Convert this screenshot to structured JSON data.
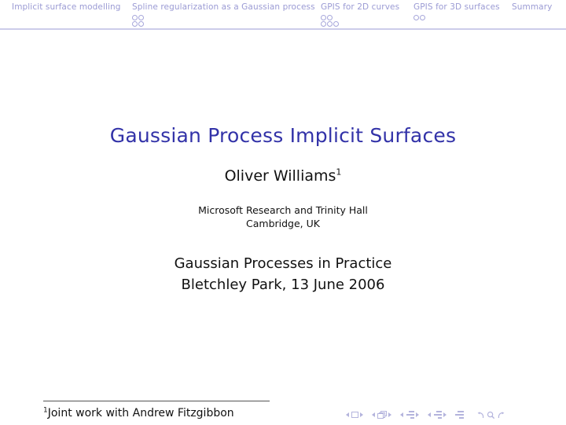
{
  "slide": {
    "type": "beamer-title-slide",
    "background_color": "#ffffff",
    "accent_color": "#3232a8",
    "nav_color": "#9b9bd4",
    "rule_color": "#ccccea"
  },
  "nav_bar": {
    "sections": [
      {
        "label": "Implicit surface modelling",
        "dot_rows": []
      },
      {
        "label": "Spline regularization as a Gaussian process",
        "dot_rows": [
          2,
          2
        ]
      },
      {
        "label": "GPIS for 2D curves",
        "dot_rows": [
          2,
          3
        ]
      },
      {
        "label": "GPIS for 3D surfaces",
        "dot_rows": [
          2
        ]
      },
      {
        "label": "Summary",
        "dot_rows": []
      }
    ]
  },
  "title_block": {
    "title": "Gaussian Process Implicit Surfaces"
  },
  "author_block": {
    "name": "Oliver Williams",
    "footnote_marker": "1"
  },
  "affiliation_block": {
    "line1": "Microsoft Research and Trinity Hall",
    "line2": "Cambridge, UK"
  },
  "event_block": {
    "line1": "Gaussian Processes in Practice",
    "line2": "Bletchley Park, 13 June 2006"
  },
  "footnote": {
    "marker": "1",
    "text": "Joint work with Andrew Fitzgibbon"
  },
  "nav_symbols": {
    "items": [
      {
        "name": "previous-slide",
        "glyph": "left-triangle"
      },
      {
        "name": "slide-indicator",
        "glyph": "square"
      },
      {
        "name": "next-slide",
        "glyph": "right-triangle"
      },
      {
        "name": "previous-frame",
        "glyph": "left-triangle"
      },
      {
        "name": "frame-indicator",
        "glyph": "stacked-frames"
      },
      {
        "name": "next-frame",
        "glyph": "right-triangle"
      },
      {
        "name": "previous-subsection",
        "glyph": "left-triangle"
      },
      {
        "name": "subsection-indicator",
        "glyph": "bars"
      },
      {
        "name": "next-subsection",
        "glyph": "right-triangle"
      },
      {
        "name": "previous-section",
        "glyph": "left-triangle"
      },
      {
        "name": "section-indicator",
        "glyph": "bars"
      },
      {
        "name": "next-section",
        "glyph": "right-triangle"
      },
      {
        "name": "document-indicator",
        "glyph": "bars-solid"
      },
      {
        "name": "back",
        "glyph": "undo-arrow"
      },
      {
        "name": "find",
        "glyph": "magnifier"
      },
      {
        "name": "forward",
        "glyph": "redo-arrow"
      }
    ]
  }
}
